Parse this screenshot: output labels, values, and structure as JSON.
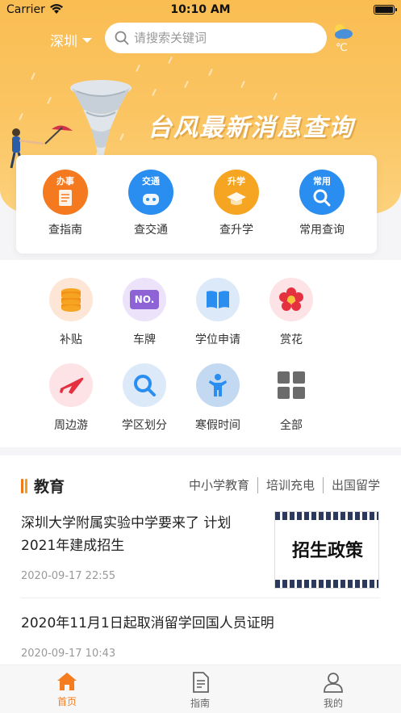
{
  "status_bar": {
    "carrier": "Carrier",
    "time": "10:10 AM"
  },
  "header": {
    "city": "深圳",
    "search_placeholder": "请搜索关键词",
    "weather_unit": "℃"
  },
  "banner": {
    "title": "台风最新消息查询"
  },
  "quick_services": [
    {
      "tag": "办事",
      "label": "查指南",
      "icon": "guide-document-icon",
      "color": "#f4791f"
    },
    {
      "tag": "交通",
      "label": "查交通",
      "icon": "robot-car-icon",
      "color": "#2a8df0"
    },
    {
      "tag": "升学",
      "label": "查升学",
      "icon": "graduation-icon",
      "color": "#f6a523"
    },
    {
      "tag": "常用",
      "label": "常用查询",
      "icon": "search-magnifier-icon",
      "color": "#2a8df0"
    }
  ],
  "services": [
    {
      "label": "补贴",
      "icon": "coins-icon"
    },
    {
      "label": "车牌",
      "icon": "license-plate-icon",
      "badge": "NO."
    },
    {
      "label": "学位申请",
      "icon": "book-icon"
    },
    {
      "label": "赏花",
      "icon": "flower-icon"
    },
    {
      "label": "周边游",
      "icon": "airplane-icon"
    },
    {
      "label": "学区划分",
      "icon": "magnifier-icon"
    },
    {
      "label": "寒假时间",
      "icon": "child-icon"
    },
    {
      "label": "全部",
      "icon": "grid-icon"
    }
  ],
  "news": {
    "section_title": "教育",
    "tabs": [
      "中小学教育",
      "培训充电",
      "出国留学"
    ],
    "articles": [
      {
        "title": "深圳大学附属实验中学要来了 计划2021年建成招生",
        "date": "2020-09-17 22:55",
        "thumb_text": "招生政策"
      },
      {
        "title": "2020年11月1日起取消留学回国人员证明",
        "date": "2020-09-17 10:43"
      }
    ]
  },
  "tabbar": [
    {
      "label": "首页",
      "icon": "home-icon",
      "active": true
    },
    {
      "label": "指南",
      "icon": "document-icon",
      "active": false
    },
    {
      "label": "我的",
      "icon": "user-icon",
      "active": false
    }
  ],
  "colors": {
    "accent": "#f57c1f",
    "hero": "#f9bd52"
  }
}
